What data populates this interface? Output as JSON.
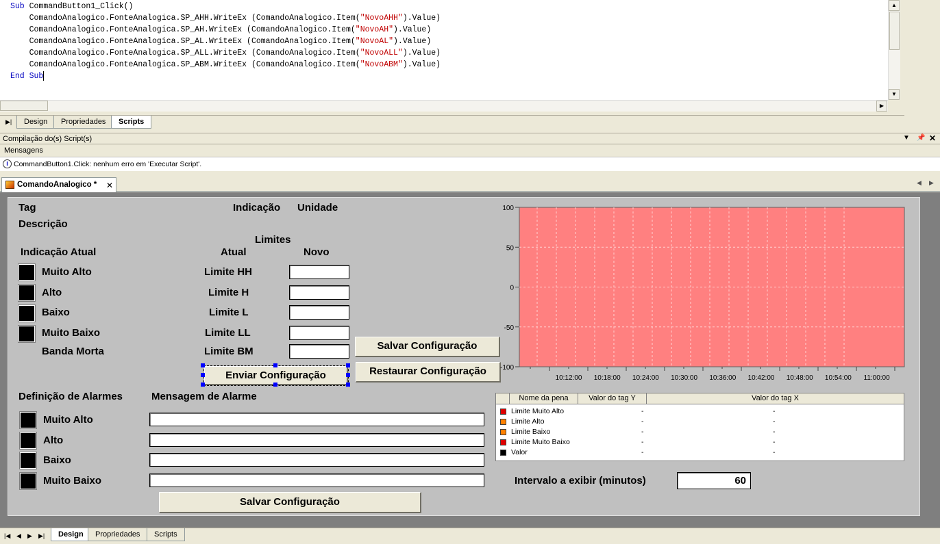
{
  "editor": {
    "lines": [
      {
        "kw": "Sub",
        "rest": " CommandButton1_Click()"
      },
      {
        "pre": "    ComandoAnalogico.FonteAnalogica.SP_AHH.WriteEx (ComandoAnalogico.Item(",
        "str": "\"NovoAHH\"",
        "post": ").Value)"
      },
      {
        "pre": "    ComandoAnalogico.FonteAnalogica.SP_AH.WriteEx (ComandoAnalogico.Item(",
        "str": "\"NovoAH\"",
        "post": ").Value)"
      },
      {
        "pre": "    ComandoAnalogico.FonteAnalogica.SP_AL.WriteEx (ComandoAnalogico.Item(",
        "str": "\"NovoAL\"",
        "post": ").Value)"
      },
      {
        "pre": "    ComandoAnalogico.FonteAnalogica.SP_ALL.WriteEx (ComandoAnalogico.Item(",
        "str": "\"NovoALL\"",
        "post": ").Value)"
      },
      {
        "pre": "    ComandoAnalogico.FonteAnalogica.SP_ABM.WriteEx (ComandoAnalogico.Item(",
        "str": "\"NovoABM\"",
        "post": ").Value)"
      },
      {
        "kw": "End Sub",
        "rest": ""
      }
    ],
    "tabs": [
      "Design",
      "Propriedades",
      "Scripts"
    ],
    "active_tab": "Scripts"
  },
  "compile": {
    "title": "Compilação do(s) Script(s)",
    "messages_header": "Mensagens",
    "message": "CommandButton1.Click: nenhum erro em 'Executar Script'."
  },
  "document": {
    "tab_title": "ComandoAnalogico *"
  },
  "screen": {
    "tag_label": "Tag",
    "indicacao_label": "Indicação",
    "unidade_label": "Unidade",
    "descricao_label": "Descrição",
    "limites_label": "Limites",
    "indicacao_atual_label": "Indicação Atual",
    "atual_label": "Atual",
    "novo_label": "Novo",
    "indicators": [
      "Muito Alto",
      "Alto",
      "Baixo",
      "Muito Baixo",
      "Banda Morta"
    ],
    "limits": [
      "Limite HH",
      "Limite H",
      "Limite L",
      "Limite LL",
      "Limite BM"
    ],
    "send_button": "Enviar Configuração",
    "save_button_top": "Salvar Configuração",
    "restore_button": "Restaurar Configuração",
    "alarm_def_label": "Definição de Alarmes",
    "alarm_msg_label": "Mensagem de Alarme",
    "alarms": [
      "Muito Alto",
      "Alto",
      "Baixo",
      "Muito Baixo"
    ],
    "save_button_bottom": "Salvar Configuração",
    "interval_label": "Intervalo a exibir (minutos)",
    "interval_value": "60"
  },
  "chart_data": {
    "type": "line",
    "y_ticks": [
      "100",
      "50",
      "0",
      "-50",
      "-100"
    ],
    "ylim": [
      -100,
      100
    ],
    "x_ticks": [
      "10:12:00",
      "10:18:00",
      "10:24:00",
      "10:30:00",
      "10:36:00",
      "10:42:00",
      "10:48:00",
      "10:54:00",
      "11:00:00"
    ],
    "plot_background": "#ff8080",
    "grid": true
  },
  "legend": {
    "headers": [
      "Nome da pena",
      "Valor do tag Y",
      "Valor do tag X"
    ],
    "rows": [
      {
        "name": "Limite Muito Alto",
        "color": "#e00000",
        "y": "-",
        "x": "-"
      },
      {
        "name": "Limite Alto",
        "color": "#ff8000",
        "y": "-",
        "x": "-"
      },
      {
        "name": "Limite Baixo",
        "color": "#ff8000",
        "y": "-",
        "x": "-"
      },
      {
        "name": "Limite Muito Baixo",
        "color": "#e00000",
        "y": "-",
        "x": "-"
      },
      {
        "name": "Valor",
        "color": "#000000",
        "y": "-",
        "x": "-"
      }
    ]
  },
  "bottom_tabs": [
    "Design",
    "Propriedades",
    "Scripts"
  ],
  "bottom_active_tab": "Design"
}
